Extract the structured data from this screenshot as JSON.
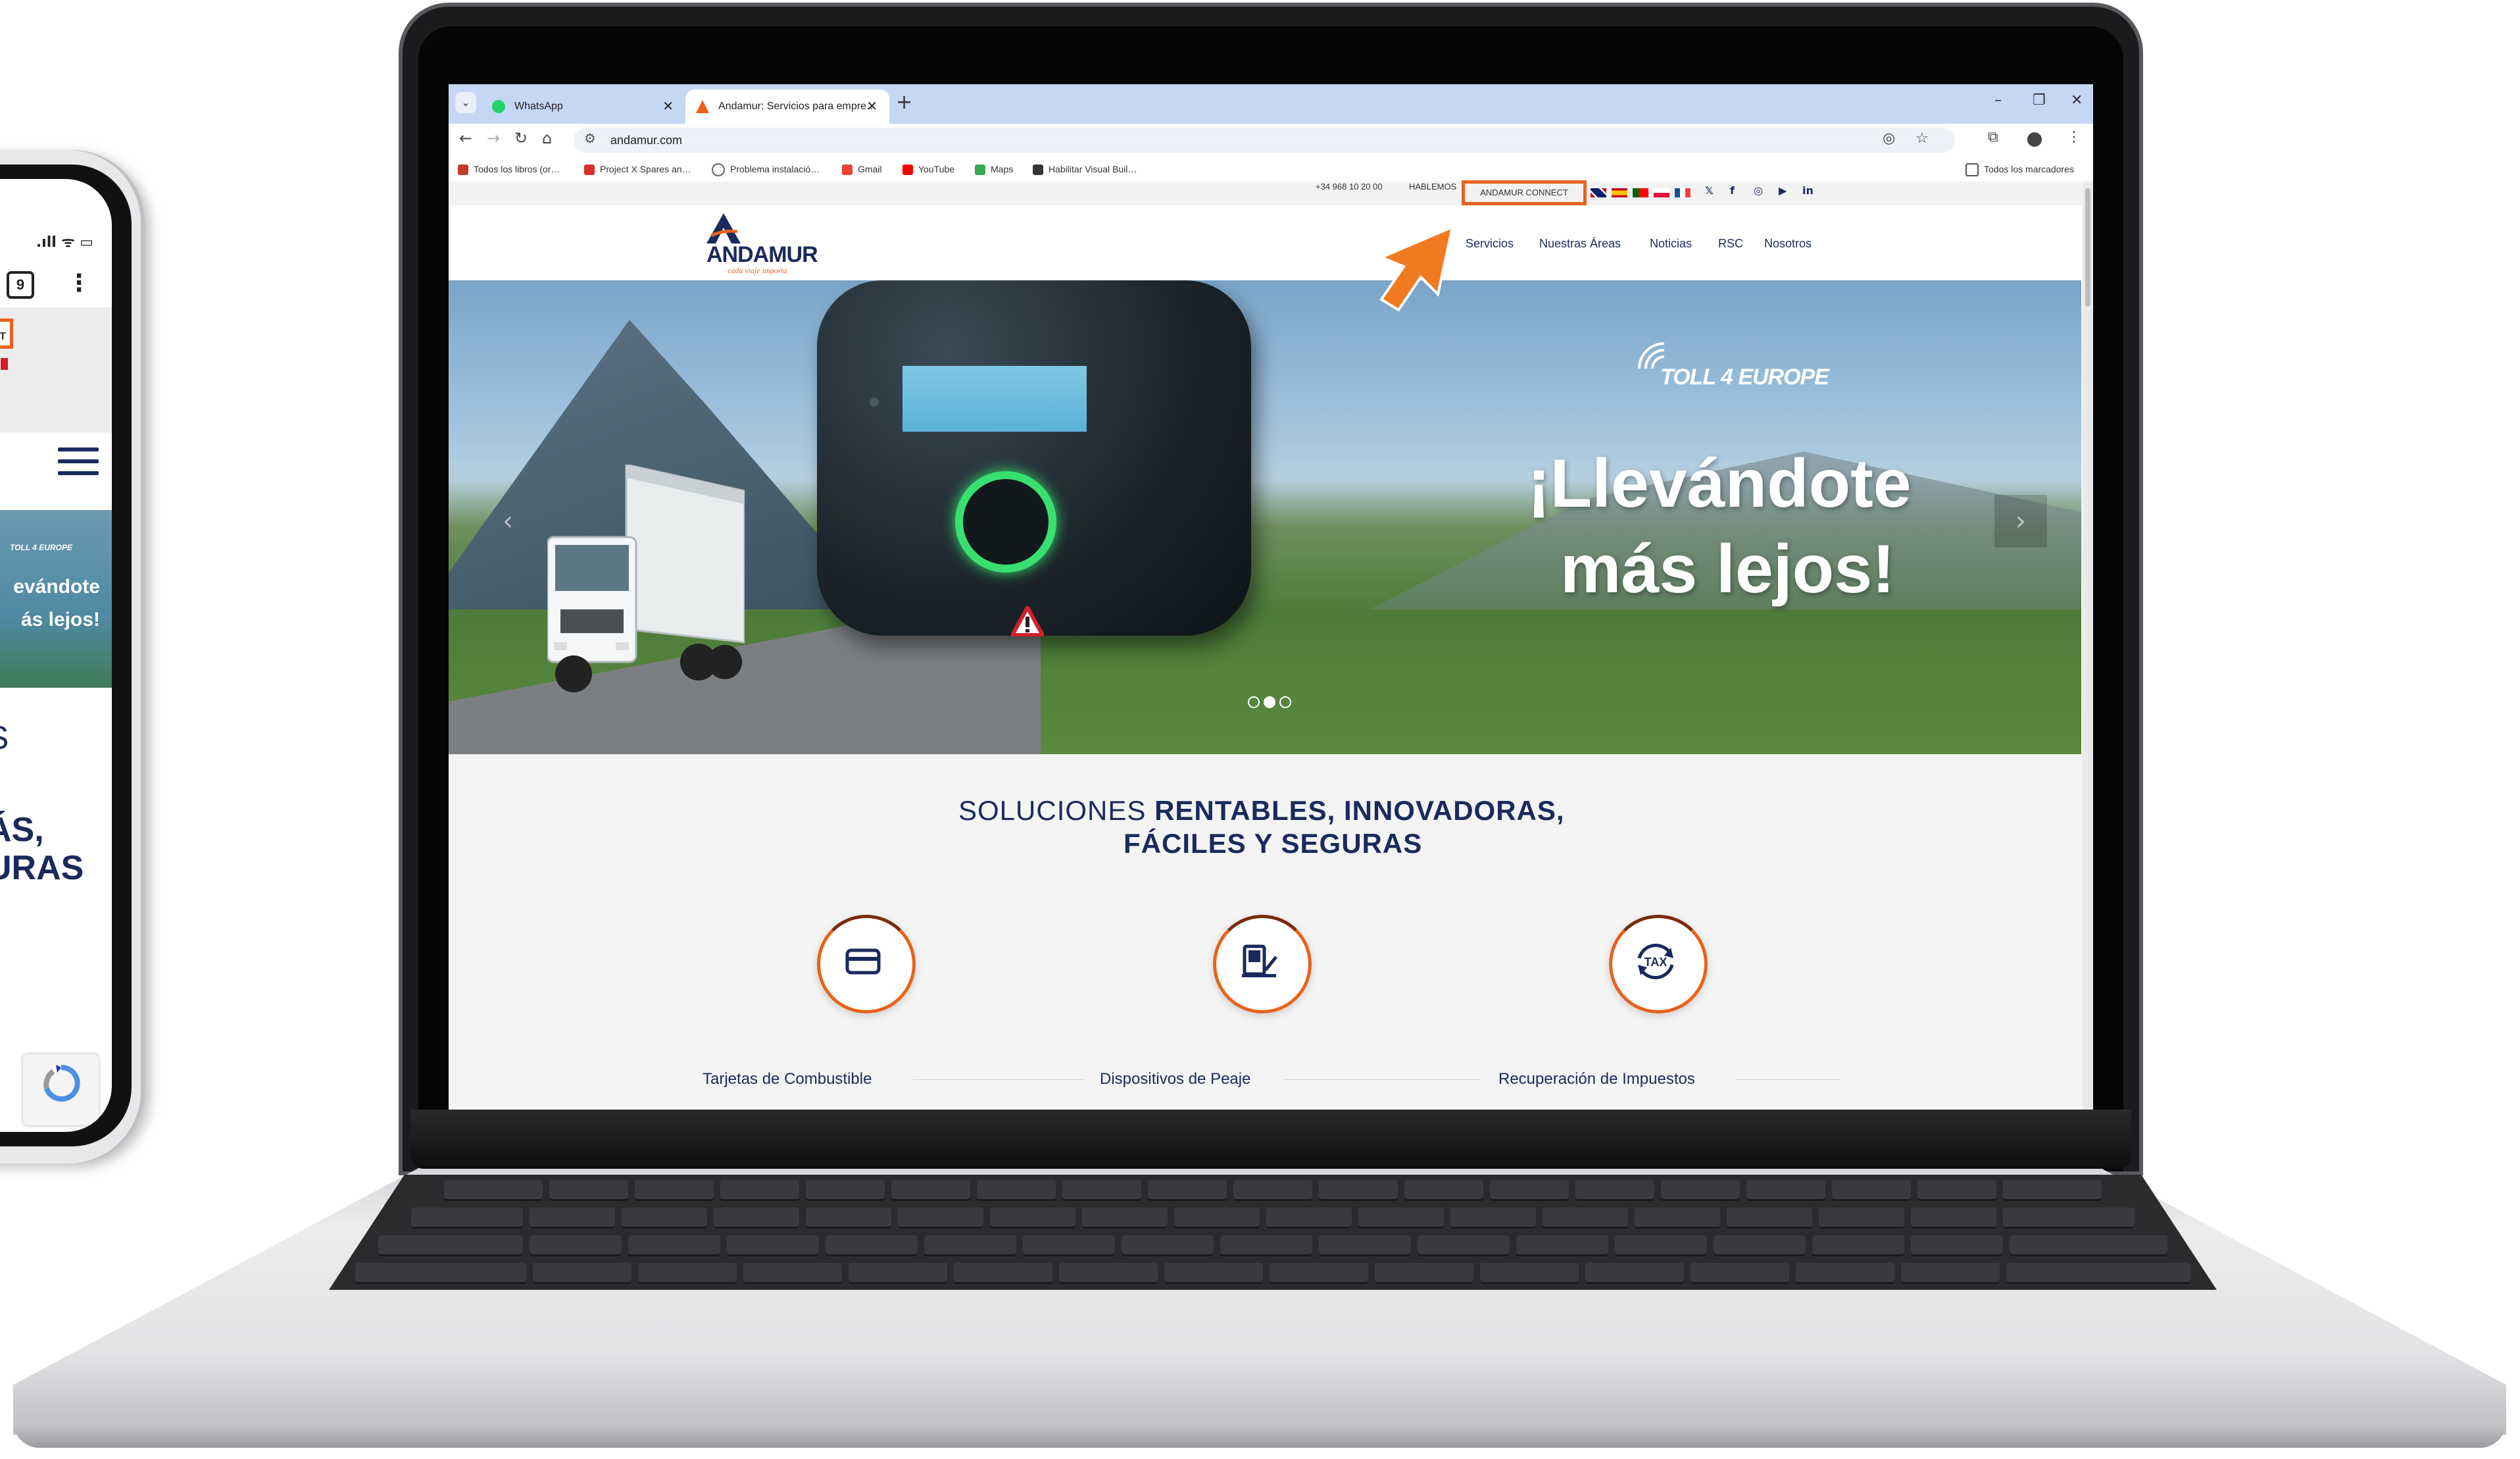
{
  "browser": {
    "tabs": [
      {
        "title": "WhatsApp",
        "active": false
      },
      {
        "title": "Andamur: Servicios para empre…",
        "active": true
      }
    ],
    "new_tab": "+",
    "window_controls": [
      "–",
      "❐",
      "✕"
    ],
    "url": "andamur.com",
    "bookmarks": [
      "Todos los libros (or…",
      "Project X Spares an…",
      "Problema instalació…",
      "Gmail",
      "YouTube",
      "Maps",
      "Habilitar Visual Buil…"
    ],
    "all_bookmarks": "Todos los marcadores"
  },
  "site": {
    "topbar": {
      "phone": "+34 968 10 20 00",
      "hablemos": "HABLEMOS",
      "connect": "ANDAMUR CONNECT",
      "languages": [
        "en",
        "es",
        "pt",
        "pl",
        "fr"
      ],
      "social_icons": [
        "twitter-icon",
        "facebook-icon",
        "instagram-icon",
        "youtube-icon",
        "linkedin-icon"
      ],
      "social_glyphs": [
        "𝕏",
        "f",
        "◎",
        "▶",
        "in"
      ]
    },
    "logo": {
      "name": "ANDAMUR",
      "slogan": "cada viaje importa"
    },
    "nav": [
      "Servicios",
      "Nuestras Áreas",
      "Noticias",
      "RSC",
      "Nosotros"
    ],
    "hero": {
      "brand": "TOLL 4 EUROPE",
      "title_line1": "¡Llevándote",
      "title_line2": "más lejos!",
      "slides": 3,
      "active_slide": 2
    },
    "solutions": {
      "prefix": "SOLUCIONES",
      "line1_bold": "RENTABLES, INNOVADORAS,",
      "line2": "FÁCILES Y SEGURAS"
    },
    "services": [
      {
        "label": "Tarjetas de Combustible",
        "icon": "card-icon"
      },
      {
        "label": "Dispositivos de Peaje",
        "icon": "toll-device-icon"
      },
      {
        "label": "Recuperación de Impuestos",
        "icon": "tax-icon"
      }
    ]
  },
  "phone": {
    "connect_partial": "T",
    "banner_brand": "TOLL 4 EUROPE",
    "banner_line1": "evándote",
    "banner_line2": "ás lejos!",
    "heading_partial": "S",
    "heading_lines": [
      "",
      "ÁS,",
      "URAS"
    ],
    "tab_count": "9",
    "status": ".ıll ᯤ ▭"
  },
  "colors": {
    "brand_navy": "#1a2a5c",
    "brand_orange": "#e8621c",
    "tab_bar": "#c6d7f5"
  }
}
